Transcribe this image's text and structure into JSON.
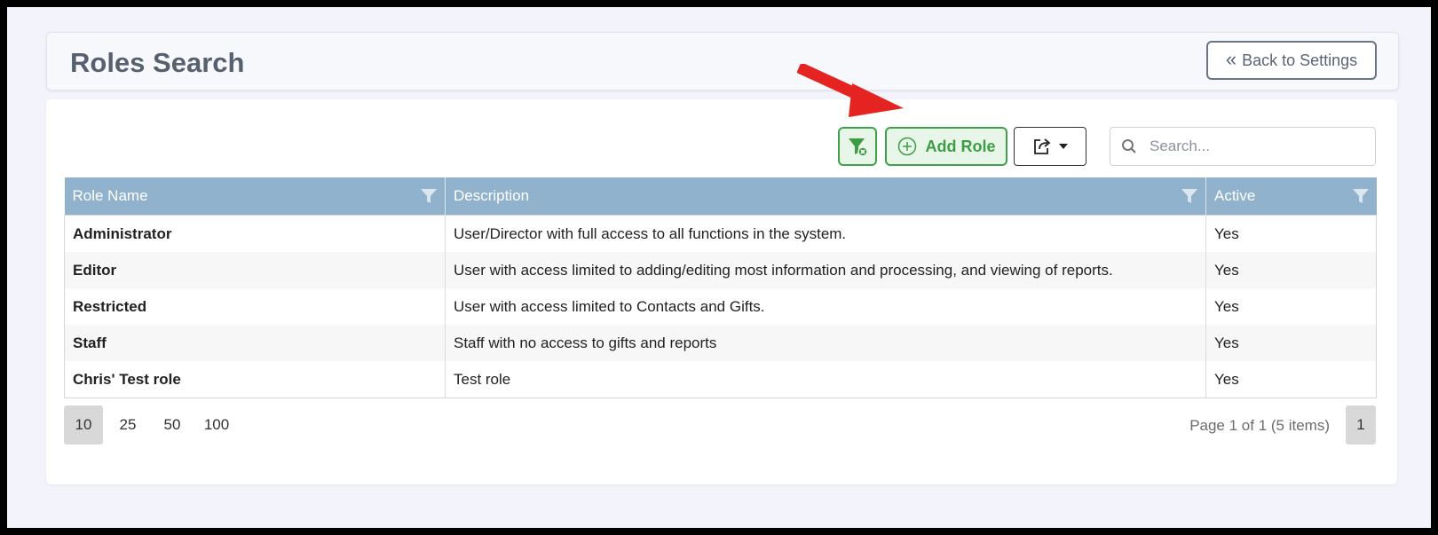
{
  "header": {
    "title": "Roles Search",
    "back_button_label": "Back to Settings"
  },
  "toolbar": {
    "add_role_label": "Add Role",
    "search_placeholder": "Search...",
    "accent_color": "#3fa24a"
  },
  "table": {
    "columns": [
      "Role Name",
      "Description",
      "Active"
    ],
    "header_color": "#91b2cc",
    "rows": [
      {
        "name": "Administrator",
        "description": "User/Director with full access to all functions in the system.",
        "active": "Yes"
      },
      {
        "name": "Editor",
        "description": "User with access limited to adding/editing most information and processing, and viewing of reports.",
        "active": "Yes"
      },
      {
        "name": "Restricted",
        "description": "User with access limited to Contacts and Gifts.",
        "active": "Yes"
      },
      {
        "name": "Staff",
        "description": "Staff with no access to gifts and reports",
        "active": "Yes"
      },
      {
        "name": "Chris' Test role",
        "description": "Test role",
        "active": "Yes"
      }
    ]
  },
  "pagination": {
    "page_sizes": [
      "10",
      "25",
      "50",
      "100"
    ],
    "selected_size": "10",
    "info": "Page 1 of 1 (5 items)",
    "current_page": "1"
  },
  "annotation": {
    "arrow_color": "#e52421"
  }
}
